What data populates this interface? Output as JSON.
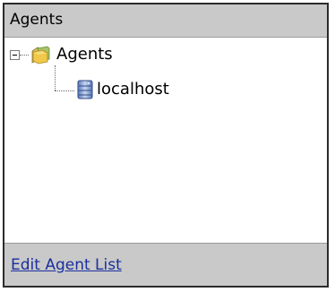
{
  "panel": {
    "title": "Agents"
  },
  "tree": {
    "root": {
      "label": "Agents",
      "expanded": true,
      "icon": "folder-icon",
      "children": [
        {
          "label": "localhost",
          "icon": "server-icon"
        }
      ]
    }
  },
  "footer": {
    "link_label": "Edit Agent List"
  },
  "colors": {
    "header_bg": "#c9c9c9",
    "link": "#1a2f9e",
    "border": "#2b2b2b"
  }
}
